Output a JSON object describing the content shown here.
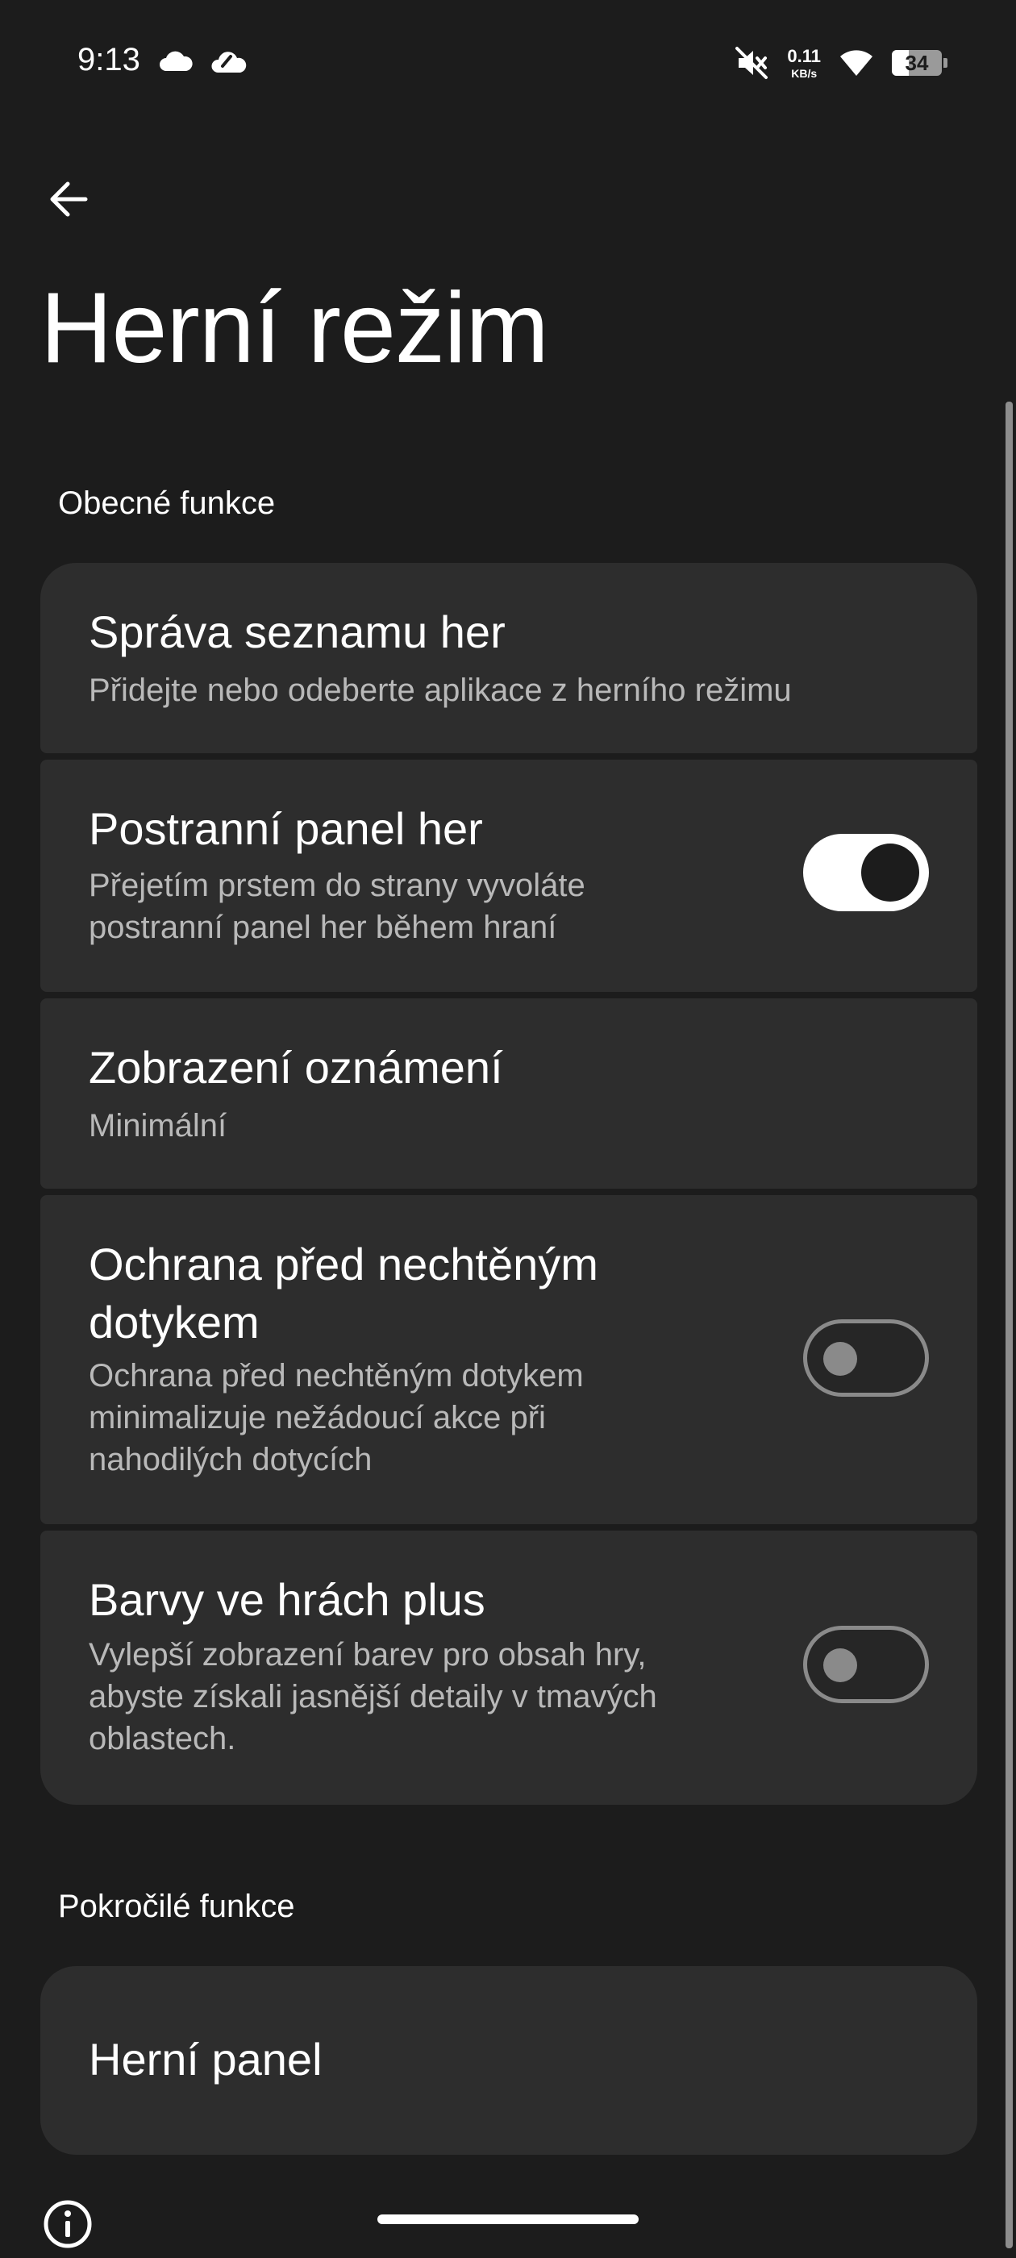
{
  "status_bar": {
    "time": "9:13",
    "net_speed_value": "0.11",
    "net_speed_unit": "KB/s",
    "battery_level": "34",
    "battery_fraction": 0.34,
    "icons": [
      "cloud-icon",
      "weather-cloud-icon",
      "mute-icon",
      "wifi-icon",
      "battery-icon"
    ]
  },
  "header": {
    "title": "Herní režim",
    "back_icon": "arrow-left-icon"
  },
  "sections": {
    "general": {
      "label": "Obecné funkce",
      "items": [
        {
          "title": "Správa seznamu her",
          "subtitle": "Přidejte nebo odeberte aplikace z herního režimu"
        },
        {
          "title": "Postranní panel her",
          "subtitle_line1": "Přejetím prstem do strany vyvoláte",
          "subtitle_line2": "postranní panel her během hraní",
          "toggle": "on"
        },
        {
          "title": "Zobrazení oznámení",
          "subtitle": "Minimální"
        },
        {
          "title_line1": "Ochrana před nechtěným",
          "title_line2": "dotykem",
          "subtitle_line1": "Ochrana před nechtěným dotykem",
          "subtitle_line2": "minimalizuje nežádoucí akce při",
          "subtitle_line3": "nahodilých dotycích",
          "toggle": "off"
        },
        {
          "title": "Barvy ve hrách plus",
          "subtitle_line1": "Vylepší zobrazení barev pro obsah hry,",
          "subtitle_line2": "abyste získali jasnější detaily v tmavých",
          "subtitle_line3": "oblastech.",
          "toggle": "off"
        }
      ]
    },
    "advanced": {
      "label": "Pokročilé funkce",
      "items": [
        {
          "title": "Herní panel"
        }
      ]
    }
  },
  "colors": {
    "background": "#1c1c1c",
    "card": "#2d2d2d",
    "text_primary": "#ffffff",
    "text_secondary": "#b9b9b9",
    "toggle_off": "#8a8a8a"
  }
}
